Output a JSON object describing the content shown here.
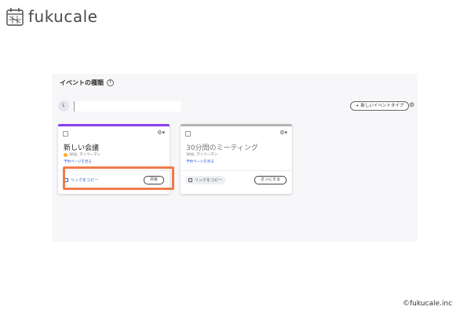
{
  "brand": {
    "logo_text": "fukucale",
    "accent": "#ef7b4a"
  },
  "panel": {
    "title": "イベントの種類",
    "help_icon": "question-circle-icon",
    "user_initial": "L",
    "new_event_label": "+ 新しいイベントタイプ",
    "settings_icon": "gear-icon"
  },
  "cards": [
    {
      "title": "新しい会議",
      "meta": "30分, マンツーマン",
      "has_warning": true,
      "link_label": "予約ページを見る",
      "copy_label": "リンクをコピー",
      "action_label": "共有",
      "accent": "#8a3ff0"
    },
    {
      "title": "30分間のミーティング",
      "meta": "30分, マンツーマン",
      "has_warning": false,
      "link_label": "予約ページを見る",
      "copy_label": "リンクをコピー",
      "action_label": "オンにする",
      "accent": "#b5b5b5"
    }
  ],
  "footer": {
    "copyright": "©fukucale.inc"
  }
}
